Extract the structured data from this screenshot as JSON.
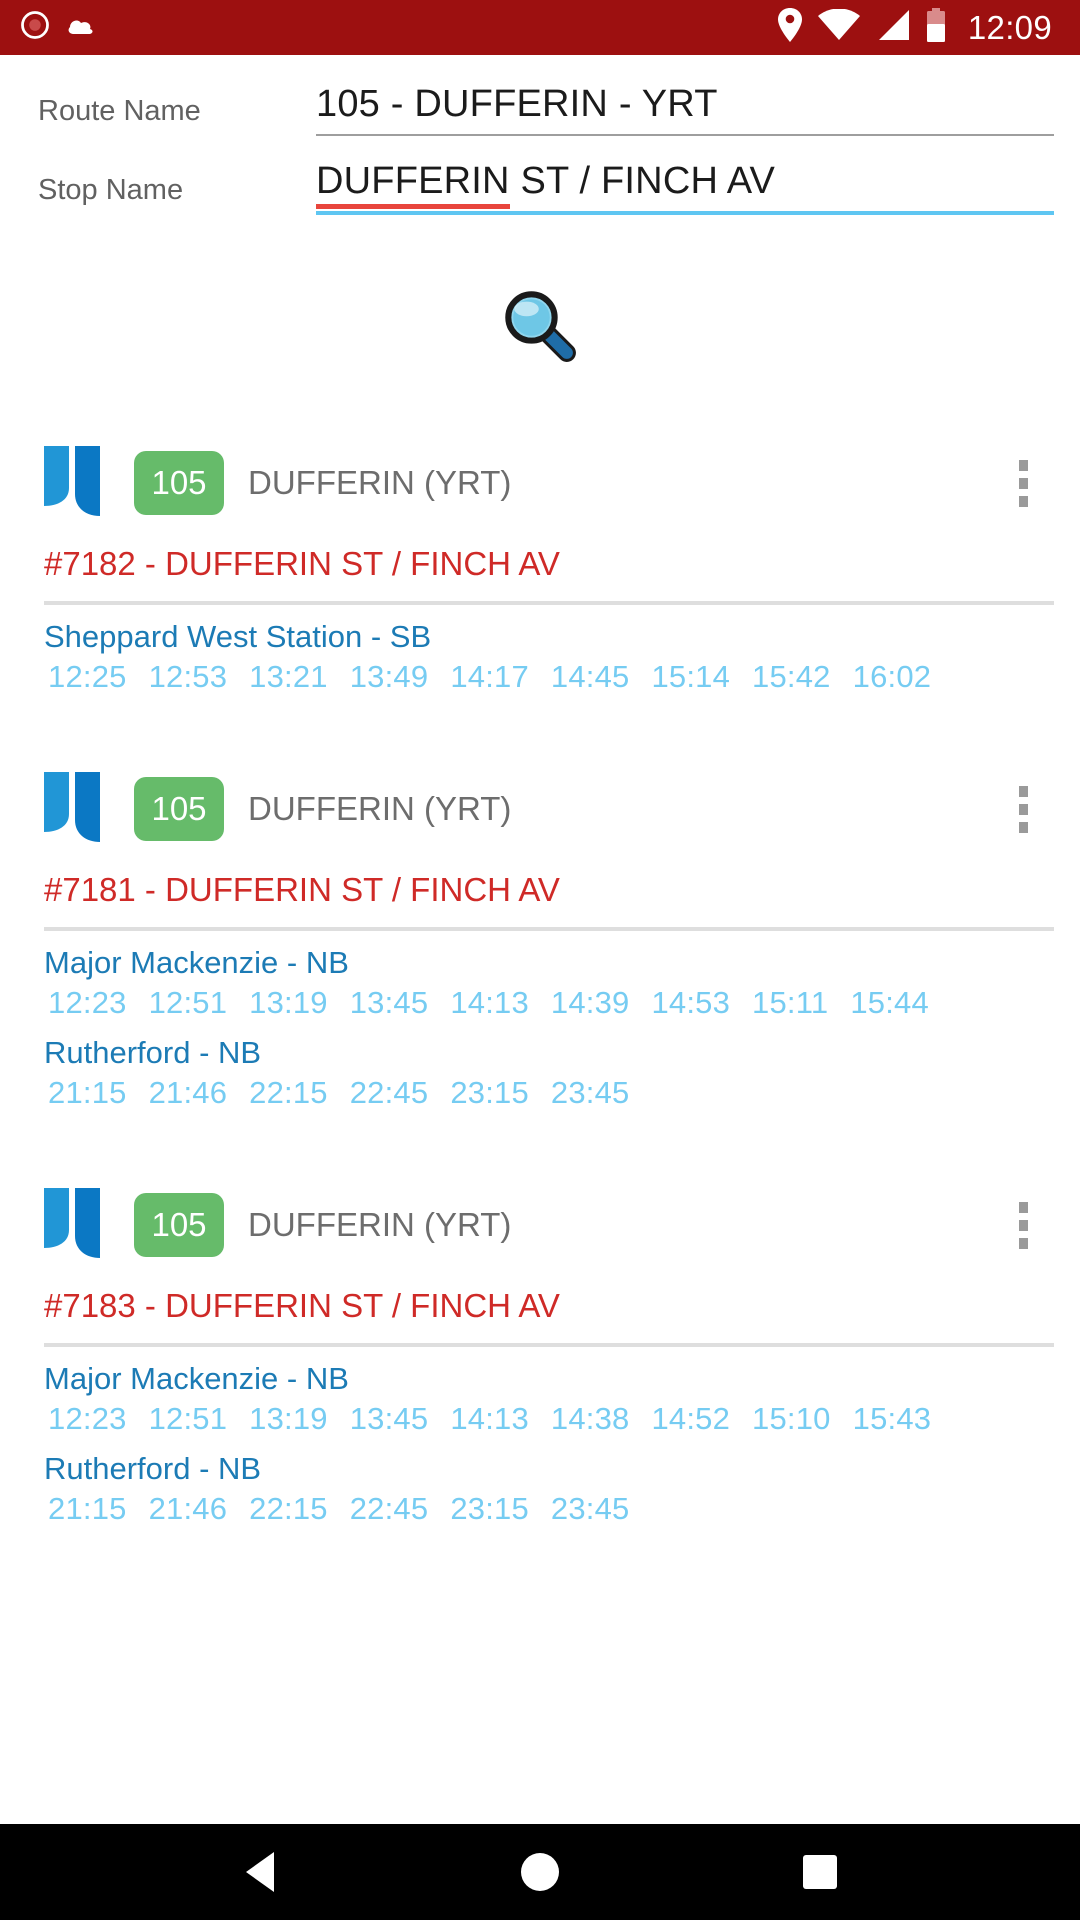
{
  "status_bar": {
    "background": "#9d1010",
    "clock": "12:09",
    "left_icons": [
      "record-icon",
      "cloud-icon"
    ],
    "right_icons": [
      "location-icon",
      "wifi-icon",
      "signal-icon",
      "battery-icon"
    ]
  },
  "form": {
    "route": {
      "label": "Route Name",
      "value": "105 - DUFFERIN - YRT",
      "underline_color": "#9e9e9e"
    },
    "stop": {
      "label": "Stop Name",
      "value_misspelled": "DUFFERIN",
      "value_rest": " ST / FINCH AV",
      "underline_color": "#5ec6f2",
      "spellcheck_color": "#e8453c"
    }
  },
  "search": {
    "icon": "magnifier-icon",
    "label": "🔍"
  },
  "colors": {
    "badge_green": "#66bb6a",
    "stop_red": "#cf2a27",
    "dest_blue": "#1c7bb5",
    "time_blue": "#76ccf2",
    "route_title_gray": "#6d6d6d"
  },
  "results": [
    {
      "route_number": "105",
      "route_title": "DUFFERIN (YRT)",
      "stop_line": "#7182 - DUFFERIN ST / FINCH AV",
      "destinations": [
        {
          "name": "Sheppard West Station - SB",
          "times": [
            "12:25",
            "12:53",
            "13:21",
            "13:49",
            "14:17",
            "14:45",
            "15:14",
            "15:42",
            "16:02"
          ]
        }
      ]
    },
    {
      "route_number": "105",
      "route_title": "DUFFERIN (YRT)",
      "stop_line": "#7181 - DUFFERIN ST / FINCH AV",
      "destinations": [
        {
          "name": "Major Mackenzie - NB",
          "times": [
            "12:23",
            "12:51",
            "13:19",
            "13:45",
            "14:13",
            "14:39",
            "14:53",
            "15:11",
            "15:44"
          ]
        },
        {
          "name": "Rutherford - NB",
          "times": [
            "21:15",
            "21:46",
            "22:15",
            "22:45",
            "23:15",
            "23:45"
          ]
        }
      ]
    },
    {
      "route_number": "105",
      "route_title": "DUFFERIN (YRT)",
      "stop_line": "#7183 - DUFFERIN ST / FINCH AV",
      "destinations": [
        {
          "name": "Major Mackenzie - NB",
          "times": [
            "12:23",
            "12:51",
            "13:19",
            "13:45",
            "14:13",
            "14:38",
            "14:52",
            "15:10",
            "15:43"
          ]
        },
        {
          "name": "Rutherford - NB",
          "times": [
            "21:15",
            "21:46",
            "22:15",
            "22:45",
            "23:15",
            "23:45"
          ]
        }
      ]
    }
  ],
  "nav_bar": {
    "back": "back-triangle-icon",
    "home": "home-circle-icon",
    "recents": "recents-square-icon"
  }
}
